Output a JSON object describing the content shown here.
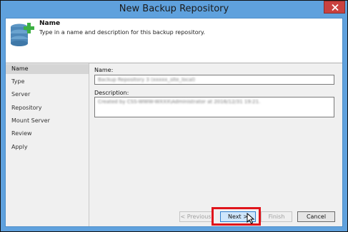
{
  "window": {
    "title": "New Backup Repository",
    "titlebar_color": "#5fa1dd"
  },
  "header": {
    "title": "Name",
    "description": "Type in a name and description for this backup repository.",
    "icon": "database-add-icon"
  },
  "sidebar": {
    "items": [
      {
        "label": "Name",
        "active": true
      },
      {
        "label": "Type",
        "active": false
      },
      {
        "label": "Server",
        "active": false
      },
      {
        "label": "Repository",
        "active": false
      },
      {
        "label": "Mount Server",
        "active": false
      },
      {
        "label": "Review",
        "active": false
      },
      {
        "label": "Apply",
        "active": false
      }
    ]
  },
  "form": {
    "name_label": "Name:",
    "name_value": "Backup Repository 3 (xxxxx_site_local)",
    "description_label": "Description:",
    "description_value": "Created by CSS-WWW-WXXX\\Administrator at 2016/12/31 19:21."
  },
  "buttons": {
    "previous": "< Previous",
    "next": "Next >",
    "finish": "Finish",
    "cancel": "Cancel"
  },
  "colors": {
    "highlight": "#e0141b",
    "accent": "#2f7fd0"
  }
}
